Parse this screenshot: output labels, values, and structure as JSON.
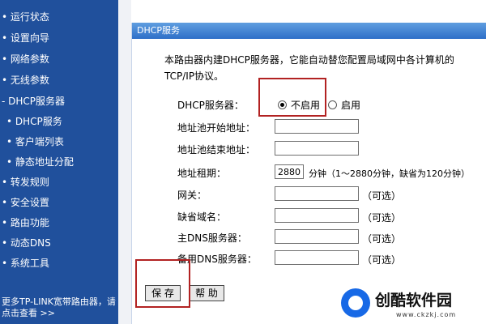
{
  "sidebar": {
    "items": [
      {
        "label": "• 运行状态"
      },
      {
        "label": "• 设置向导"
      },
      {
        "label": "• 网络参数"
      },
      {
        "label": "• 无线参数"
      },
      {
        "label": "- DHCP服务器"
      },
      {
        "label": "• DHCP服务"
      },
      {
        "label": "• 客户端列表"
      },
      {
        "label": "• 静态地址分配"
      },
      {
        "label": "• 转发规则"
      },
      {
        "label": "• 安全设置"
      },
      {
        "label": "• 路由功能"
      },
      {
        "label": "• 动态DNS"
      },
      {
        "label": "• 系统工具"
      }
    ],
    "footer": "更多TP-LINK宽带路由器，请点击查看 >>"
  },
  "panel": {
    "title": "DHCP服务",
    "description": "本路由器内建DHCP服务器，它能自动替您配置局域网中各计算机的TCP/IP协议。",
    "server_label": "DHCP服务器：",
    "radio_disable": "不启用",
    "radio_enable": "启用",
    "pool_start_label": "地址池开始地址：",
    "pool_start_value": "",
    "pool_end_label": "地址池结束地址：",
    "pool_end_value": "",
    "lease_label": "地址租期：",
    "lease_value": "2880",
    "lease_hint": "分钟（1～2880分钟，缺省为120分钟）",
    "gateway_label": "网关：",
    "domain_label": "缺省域名：",
    "dns1_label": "主DNS服务器：",
    "dns2_label": "备用DNS服务器：",
    "optional": "（可选）",
    "save_button": "保 存",
    "help_button": "帮 助"
  },
  "watermark": {
    "name": "创酷软件园",
    "url": "www.ckzkj.com"
  },
  "colors": {
    "sidebar_bg": "#20509c",
    "header_bg": "#2e6fc8",
    "highlight": "#b22222"
  }
}
